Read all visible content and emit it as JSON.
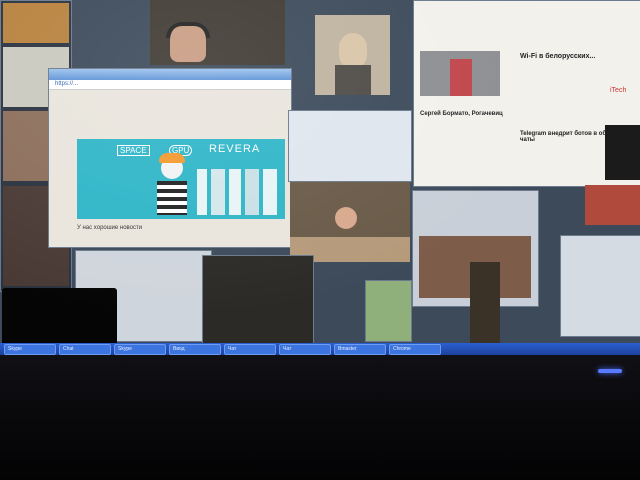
{
  "scene": {
    "description_free": true
  },
  "browser_window": {
    "address": "https://...",
    "banner": {
      "brand_left": "SPACE",
      "brand_mid": "GPU",
      "brand_right": "REVERA",
      "background": "#2fb6c8"
    },
    "caption": "У нас хорошие новости"
  },
  "news_window": {
    "headline_1": "Wi-Fi в белорусских...",
    "headline_2": "Сергей Бормато, Рогачевиц",
    "headline_3": "Telegram внедрит ботов в обычные чаты",
    "brand": "iTech"
  },
  "taskbar": {
    "items": [
      "Skype",
      "Chat",
      "Skype",
      "Ввод",
      "Чат",
      "Чат",
      "Bmaster",
      "Chrome"
    ]
  },
  "colors": {
    "taskbar": "#2b5fd0",
    "screen_bg": "#3c4a5a",
    "banner": "#2fb6c8",
    "led": "#5a7bff"
  }
}
